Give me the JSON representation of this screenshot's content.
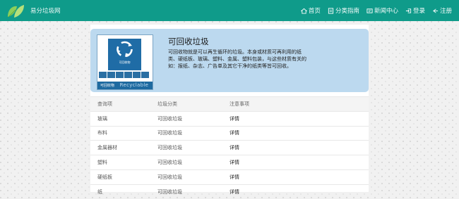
{
  "header": {
    "site_name": "易分垃圾网",
    "nav": [
      {
        "label": "首页",
        "icon": "home-icon"
      },
      {
        "label": "分类指南",
        "icon": "guide-icon"
      },
      {
        "label": "新闻中心",
        "icon": "news-icon"
      },
      {
        "label": "登录",
        "icon": "login-icon"
      },
      {
        "label": "注册",
        "icon": "register-icon"
      }
    ]
  },
  "category": {
    "title": "可回收垃圾",
    "description": "可回收物就是可以再生循环的垃圾。本身或材质可再利用的纸类、硬纸板、玻璃、塑料、金属、塑料包装，与这些材质有关的如：报纸、杂志、广告单及其它干净的纸类等皆可回收。",
    "image_label_cn": "可回收物",
    "image_label_en": "Recyclable",
    "bin_label": "可回收物"
  },
  "table": {
    "headers": [
      "查询项",
      "垃圾分类",
      "注意事项"
    ],
    "rows": [
      [
        "玻璃",
        "可回收垃圾",
        "详情"
      ],
      [
        "布料",
        "可回收垃圾",
        "详情"
      ],
      [
        "金属器材",
        "可回收垃圾",
        "详情"
      ],
      [
        "塑料",
        "可回收垃圾",
        "详情"
      ],
      [
        "硬纸板",
        "可回收垃圾",
        "详情"
      ],
      [
        "纸",
        "可回收垃圾",
        "详情"
      ]
    ]
  },
  "colors": {
    "header_bg": "#0f9b8a",
    "card_bg": "#bcd9ef",
    "bin_blue": "#1f6ca6"
  }
}
